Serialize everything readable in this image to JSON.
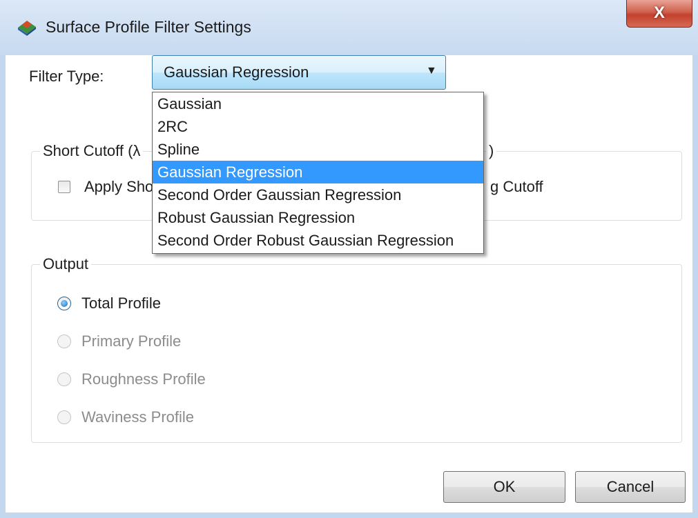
{
  "window": {
    "title": "Surface Profile Filter Settings",
    "close_label": "X"
  },
  "filter": {
    "label": "Filter Type:",
    "selected": "Gaussian Regression",
    "options": [
      "Gaussian",
      "2RC",
      "Spline",
      "Gaussian Regression",
      "Second Order Gaussian Regression",
      "Robust Gaussian Regression",
      "Second Order Robust Gaussian Regression"
    ],
    "highlighted_index": 3
  },
  "cutoff": {
    "group_visible_left": "Short Cutoff (λ",
    "group_visible_right": ")",
    "apply_short_visible": "Apply Sho",
    "apply_long_visible": "g Cutoff"
  },
  "output": {
    "title": "Output",
    "options": [
      {
        "label": "Total Profile",
        "checked": true,
        "enabled": true
      },
      {
        "label": "Primary Profile",
        "checked": false,
        "enabled": false
      },
      {
        "label": "Roughness Profile",
        "checked": false,
        "enabled": false
      },
      {
        "label": "Waviness Profile",
        "checked": false,
        "enabled": false
      }
    ]
  },
  "buttons": {
    "ok": "OK",
    "cancel": "Cancel"
  },
  "colors": {
    "selection": "#3399ff",
    "combo_border": "#3c7fb1",
    "close_red": "#c4412d"
  }
}
